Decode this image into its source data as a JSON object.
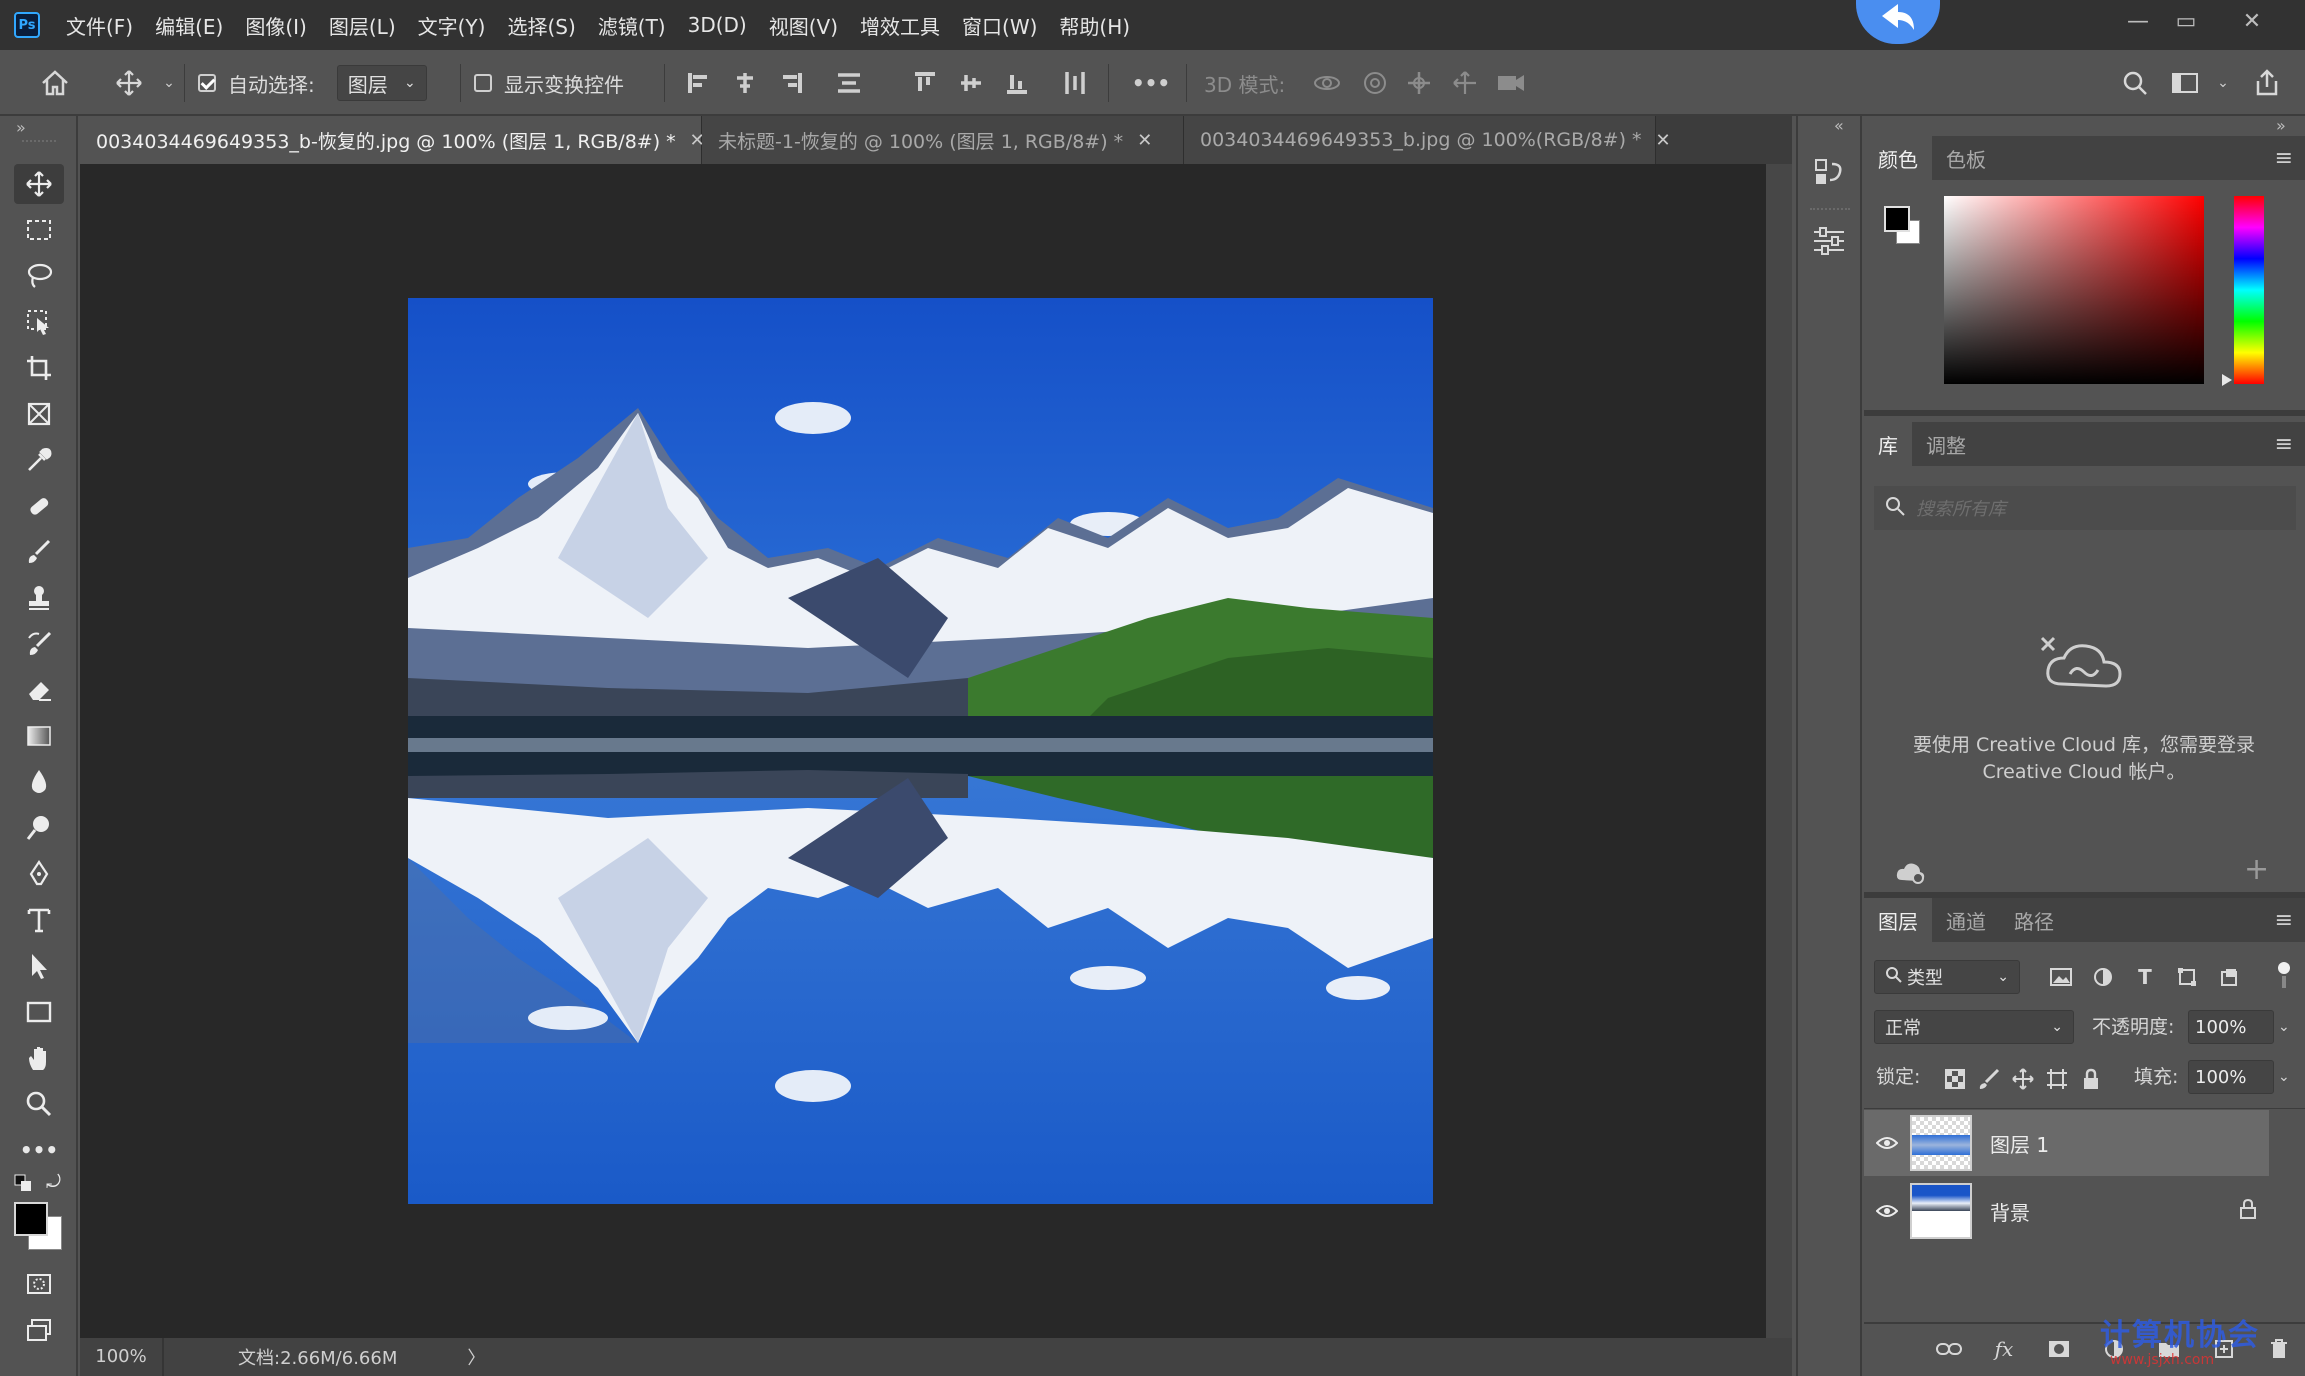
{
  "app": {
    "logo": "Ps",
    "menu": [
      "文件(F)",
      "编辑(E)",
      "图像(I)",
      "图层(L)",
      "文字(Y)",
      "选择(S)",
      "滤镜(T)",
      "3D(D)",
      "视图(V)",
      "增效工具",
      "窗口(W)",
      "帮助(H)"
    ],
    "window_controls": {
      "minimize": "—",
      "maximize": "▭",
      "close": "✕"
    }
  },
  "options_bar": {
    "auto_select_label": "自动选择:",
    "auto_select_checked": true,
    "auto_select_target": "图层",
    "show_transform_label": "显示变换控件",
    "show_transform_checked": false,
    "more": "•••",
    "mode_3d_label": "3D 模式:"
  },
  "tabs": [
    {
      "label": "0034034469649353_b-恢复的.jpg @ 100% (图层 1, RGB/8#) *",
      "close": "✕",
      "active": true
    },
    {
      "label": "未标题-1-恢复的 @ 100% (图层 1, RGB/8#) *",
      "close": "✕",
      "active": false
    },
    {
      "label": "0034034469649353_b.jpg @ 100%(RGB/8#) *",
      "close": "✕",
      "active": false
    }
  ],
  "status": {
    "zoom": "100%",
    "doc_size": "文档:2.66M/6.66M",
    "arrow": "〉"
  },
  "color_panel": {
    "tabs": [
      "颜色",
      "色板"
    ],
    "foreground": "#000000",
    "background": "#ffffff",
    "hue": "#ff0000"
  },
  "library_panel": {
    "tabs": [
      "库",
      "调整"
    ],
    "search_placeholder": "搜索所有库",
    "message": "要使用 Creative Cloud 库，您需要登录 Creative Cloud 帐户。",
    "add": "+"
  },
  "layers_panel": {
    "tabs": [
      "图层",
      "通道",
      "路径"
    ],
    "filter_type": "类型",
    "blend_mode": "正常",
    "opacity_label": "不透明度:",
    "opacity_value": "100%",
    "lock_label": "锁定:",
    "fill_label": "填充:",
    "fill_value": "100%",
    "layers": [
      {
        "name": "图层 1",
        "visible": true,
        "selected": true,
        "locked": false
      },
      {
        "name": "背景",
        "visible": true,
        "selected": false,
        "locked": true
      }
    ],
    "footer_fx": "fx"
  },
  "watermark": "计算机协会",
  "watermark_url": "www.jsjxh.com"
}
